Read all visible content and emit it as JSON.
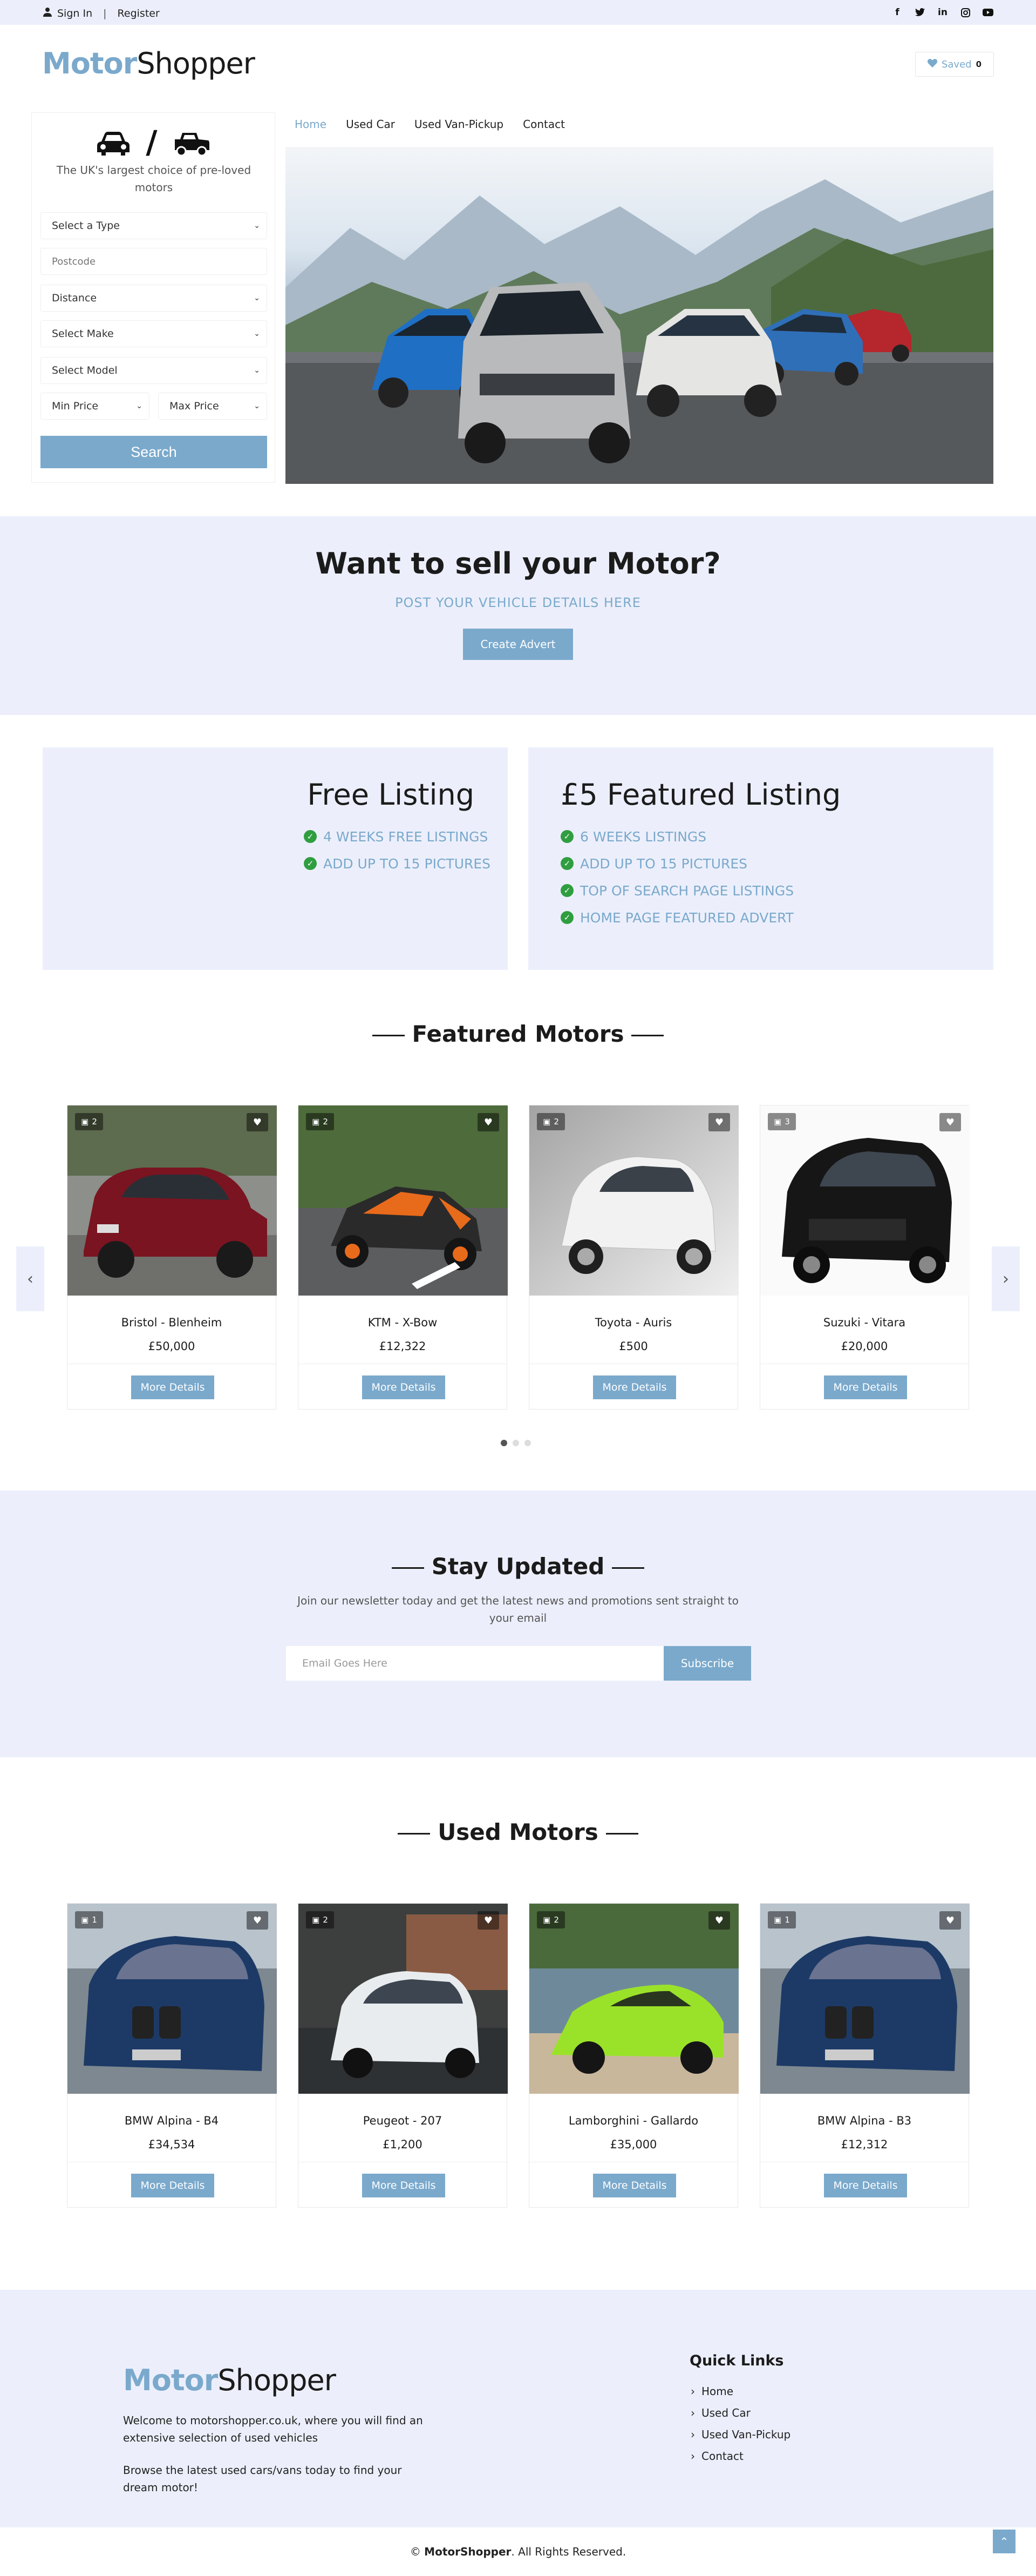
{
  "topbar": {
    "sign_in": "Sign In",
    "register": "Register",
    "social": [
      "facebook-icon",
      "twitter-icon",
      "linkedin-icon",
      "instagram-icon",
      "youtube-icon"
    ]
  },
  "header": {
    "logo_a": "Motor",
    "logo_b": "Shopper",
    "saved_label": "Saved",
    "saved_count": "0"
  },
  "search": {
    "tagline": "The UK's largest choice of pre-loved motors",
    "type_placeholder": "Select a Type",
    "postcode_placeholder": "Postcode",
    "distance": "Distance",
    "make": "Select Make",
    "model": "Select Model",
    "min_price": "Min Price",
    "max_price": "Max Price",
    "button": "Search"
  },
  "nav": [
    "Home",
    "Used Car",
    "Used Van-Pickup",
    "Contact"
  ],
  "sell": {
    "title": "Want to sell your Motor?",
    "subtitle": "POST YOUR VEHICLE DETAILS HERE",
    "button": "Create Advert"
  },
  "free_listing": {
    "title": "Free Listing",
    "items": [
      "4 WEEKS FREE LISTINGS",
      "ADD UP TO 15 PICTURES"
    ]
  },
  "featured_listing": {
    "title": "£5 Featured Listing",
    "items": [
      "6 WEEKS LISTINGS",
      "ADD UP TO 15 PICTURES",
      "TOP OF SEARCH PAGE LISTINGS",
      "HOME PAGE FEATURED ADVERT"
    ]
  },
  "featured": {
    "title": "Featured Motors",
    "cards": [
      {
        "photos": "2",
        "name": "Bristol - Blenheim",
        "price": "£50,000",
        "button": "More Details"
      },
      {
        "photos": "2",
        "name": "KTM - X-Bow",
        "price": "£12,322",
        "button": "More Details"
      },
      {
        "photos": "2",
        "name": "Toyota - Auris",
        "price": "£500",
        "button": "More Details"
      },
      {
        "photos": "3",
        "name": "Suzuki - Vitara",
        "price": "£20,000",
        "button": "More Details"
      }
    ]
  },
  "newsletter": {
    "title": "Stay Updated",
    "description": "Join our newsletter today and get the latest news and promotions sent straight to your email",
    "placeholder": "Email Goes Here",
    "button": "Subscribe"
  },
  "used": {
    "title": "Used Motors",
    "cards": [
      {
        "photos": "1",
        "name": "BMW Alpina - B4",
        "price": "£34,534",
        "button": "More Details"
      },
      {
        "photos": "2",
        "name": "Peugeot - 207",
        "price": "£1,200",
        "button": "More Details"
      },
      {
        "photos": "2",
        "name": "Lamborghini - Gallardo",
        "price": "£35,000",
        "button": "More Details"
      },
      {
        "photos": "1",
        "name": "BMW Alpina - B3",
        "price": "£12,312",
        "button": "More Details"
      }
    ]
  },
  "footer": {
    "logo_a": "Motor",
    "logo_b": "Shopper",
    "text1": "Welcome to motorshopper.co.uk, where you will find an extensive selection of used vehicles",
    "text2": "Browse the latest used cars/vans today to find your dream motor!",
    "quick_links_title": "Quick Links",
    "links": [
      "Home",
      "Used Car",
      "Used Van-Pickup",
      "Contact"
    ]
  },
  "copyright": {
    "prefix": "© ",
    "brand": "MotorShopper",
    "suffix": ". All Rights Reserved."
  },
  "colors": {
    "accent": "#7aa9cc",
    "band": "#eceffb",
    "check": "#2f9e3f"
  }
}
